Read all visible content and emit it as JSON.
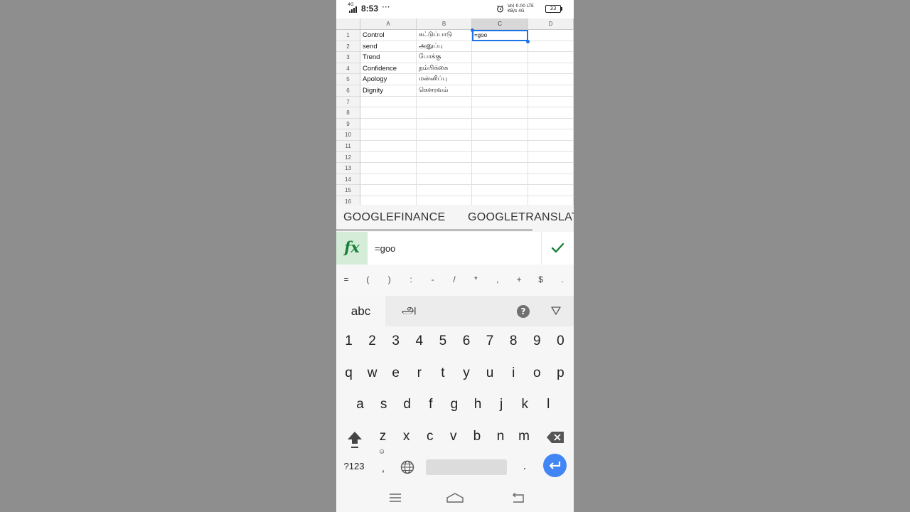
{
  "status_bar": {
    "network": "4G",
    "time": "8:53",
    "more": "···",
    "net_info": "Vo) 0.00 LTE KB/s 4G",
    "battery": "33"
  },
  "sheet": {
    "columns": [
      "A",
      "B",
      "C",
      "D"
    ],
    "active_column": "C",
    "row_numbers": [
      "1",
      "2",
      "3",
      "4",
      "5",
      "6",
      "7",
      "8",
      "9",
      "10",
      "11",
      "12",
      "13",
      "14",
      "15",
      "16"
    ],
    "rows": [
      {
        "a": "Control",
        "b": "கட்டுப்பாடு",
        "c": "=goo"
      },
      {
        "a": "send",
        "b": "அனுப்பு",
        "c": ""
      },
      {
        "a": "Trend",
        "b": "போக்கு",
        "c": ""
      },
      {
        "a": "Confidence",
        "b": "நம்பிக்கை",
        "c": ""
      },
      {
        "a": "Apology",
        "b": "மன்னிப்பு",
        "c": ""
      },
      {
        "a": "Dignity",
        "b": "கௌரவம்",
        "c": ""
      }
    ]
  },
  "suggestions": [
    "GOOGLEFINANCE",
    "GOOGLETRANSLATE"
  ],
  "formula_bar": {
    "fx_label": "fx",
    "value": "=goo"
  },
  "symbols": [
    "=",
    "(",
    ")",
    ":",
    "-",
    "/",
    "*",
    ",",
    "+",
    "$",
    "."
  ],
  "keyboard": {
    "tab_abc": "abc",
    "tab_tamil": "அ",
    "help": "?",
    "number_row": [
      "1",
      "2",
      "3",
      "4",
      "5",
      "6",
      "7",
      "8",
      "9",
      "0"
    ],
    "row1": [
      "q",
      "w",
      "e",
      "r",
      "t",
      "y",
      "u",
      "i",
      "o",
      "p"
    ],
    "row2": [
      "a",
      "s",
      "d",
      "f",
      "g",
      "h",
      "j",
      "k",
      "l"
    ],
    "row3": [
      "z",
      "x",
      "c",
      "v",
      "b",
      "n",
      "m"
    ],
    "symbols_key": "?123",
    "comma_key": ",",
    "period_key": "."
  }
}
